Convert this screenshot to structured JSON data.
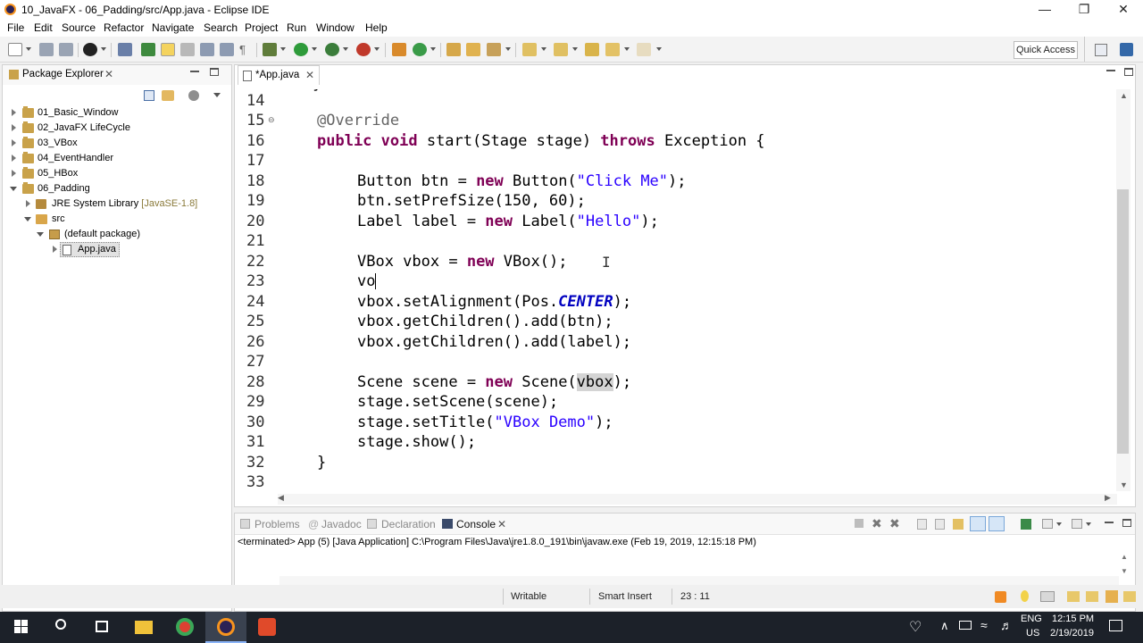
{
  "window": {
    "title": "10_JavaFX - 06_Padding/src/App.java - Eclipse IDE"
  },
  "menu": [
    "File",
    "Edit",
    "Source",
    "Refactor",
    "Navigate",
    "Search",
    "Project",
    "Run",
    "Window",
    "Help"
  ],
  "toolbar": {
    "quick_access": "Quick Access"
  },
  "package_explorer": {
    "title": "Package Explorer",
    "items": [
      {
        "label": "01_Basic_Window"
      },
      {
        "label": "02_JavaFX LifeCycle"
      },
      {
        "label": "03_VBox"
      },
      {
        "label": "04_EventHandler"
      },
      {
        "label": "05_HBox"
      },
      {
        "label": "06_Padding"
      },
      {
        "label": "JRE System Library",
        "suffix": "[JavaSE-1.8]"
      },
      {
        "label": "src"
      },
      {
        "label": "(default package)"
      },
      {
        "label": "App.java"
      }
    ]
  },
  "editor": {
    "tab_label": "*App.java",
    "lines": [
      {
        "n": "14"
      },
      {
        "n": "15"
      },
      {
        "n": "16"
      },
      {
        "n": "17"
      },
      {
        "n": "18"
      },
      {
        "n": "19"
      },
      {
        "n": "20"
      },
      {
        "n": "21"
      },
      {
        "n": "22"
      },
      {
        "n": "23"
      },
      {
        "n": "24"
      },
      {
        "n": "25"
      },
      {
        "n": "26"
      },
      {
        "n": "27"
      },
      {
        "n": "28"
      },
      {
        "n": "29"
      },
      {
        "n": "30"
      },
      {
        "n": "31"
      },
      {
        "n": "32"
      },
      {
        "n": "33"
      }
    ],
    "code": {
      "l15": "@Override",
      "l16a": "public void",
      "l16b": " start(Stage stage) ",
      "l16c": "throws",
      "l16d": " Exception {",
      "l18a": "Button btn = ",
      "l18b": "new",
      "l18c": " Button(",
      "l18d": "\"Click Me\"",
      "l18e": ");",
      "l19": "btn.setPrefSize(150, 60);",
      "l20a": "Label label = ",
      "l20b": "new",
      "l20c": " Label(",
      "l20d": "\"Hello\"",
      "l20e": ");",
      "l22a": "VBox vbox = ",
      "l22b": "new",
      "l22c": " VBox();",
      "l23": "vo",
      "l24a": "vbox.setAlignment(Pos.",
      "l24b": "CENTER",
      "l24c": ");",
      "l25": "vbox.getChildren().add(btn);",
      "l26": "vbox.getChildren().add(label);",
      "l28a": "Scene scene = ",
      "l28b": "new",
      "l28c": " Scene(",
      "l28d": "vbox",
      "l28e": ");",
      "l29": "stage.setScene(scene);",
      "l30a": "stage.setTitle(",
      "l30b": "\"VBox Demo\"",
      "l30c": ");",
      "l31": "stage.show();",
      "l32": "}"
    }
  },
  "console": {
    "tabs": [
      "Problems",
      "Javadoc",
      "Declaration",
      "Console"
    ],
    "output": "<terminated> App (5) [Java Application] C:\\Program Files\\Java\\jre1.8.0_191\\bin\\javaw.exe (Feb 19, 2019, 12:15:18 PM)"
  },
  "status": {
    "writable": "Writable",
    "insert_mode": "Smart Insert",
    "position": "23 : 11"
  },
  "taskbar": {
    "lang": "ENG",
    "region": "US",
    "time": "12:15 PM",
    "date": "2/19/2019"
  }
}
